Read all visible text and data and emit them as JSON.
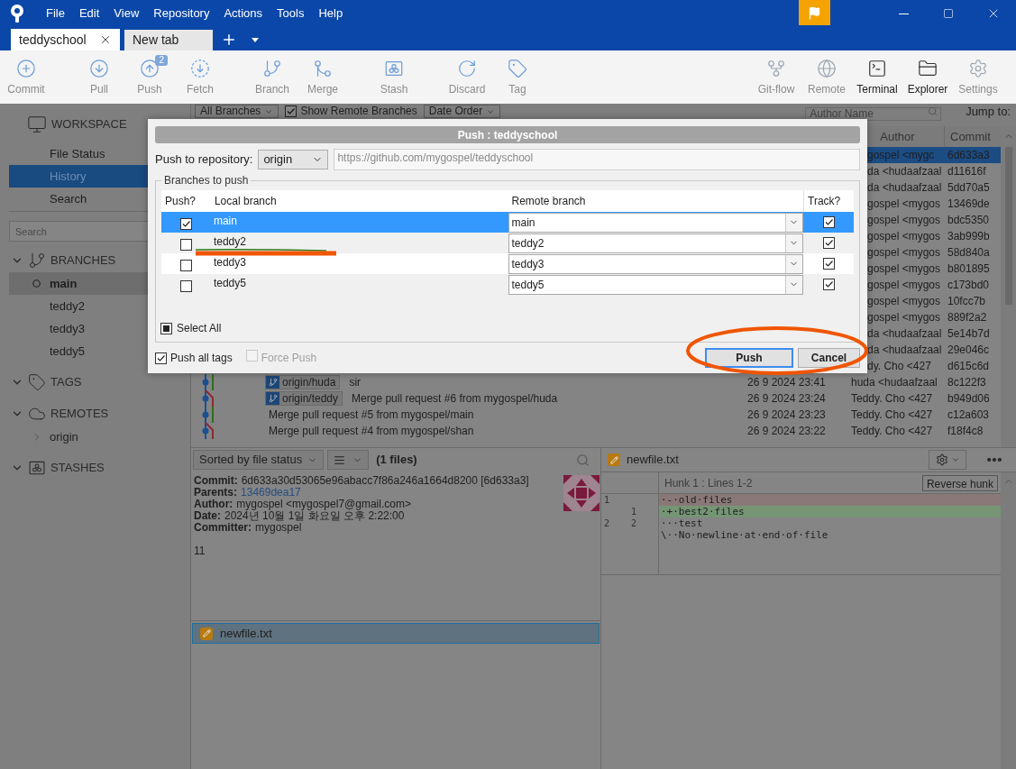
{
  "menu": [
    "File",
    "Edit",
    "View",
    "Repository",
    "Actions",
    "Tools",
    "Help"
  ],
  "tabs": [
    {
      "label": "teddyschool",
      "selected": true
    },
    {
      "label": "New tab",
      "selected": false
    }
  ],
  "toolbar": {
    "left": [
      {
        "kind": "commit",
        "label": "Commit",
        "highlighted": false
      },
      {
        "kind": "pull",
        "label": "Pull",
        "highlighted": false
      },
      {
        "kind": "push",
        "label": "Push",
        "badge": "2",
        "highlighted": false
      },
      {
        "kind": "fetch",
        "label": "Fetch",
        "highlighted": false
      },
      {
        "kind": "branch",
        "label": "Branch",
        "highlighted": false
      },
      {
        "kind": "merge",
        "label": "Merge",
        "highlighted": false
      },
      {
        "kind": "stash",
        "label": "Stash",
        "highlighted": false
      },
      {
        "kind": "discard",
        "label": "Discard",
        "highlighted": false
      },
      {
        "kind": "tag",
        "label": "Tag",
        "highlighted": false
      }
    ],
    "right": [
      {
        "kind": "gitflow",
        "label": "Git-flow",
        "highlighted": false
      },
      {
        "kind": "remote",
        "label": "Remote",
        "highlighted": false
      },
      {
        "kind": "terminal",
        "label": "Terminal",
        "highlighted": true
      },
      {
        "kind": "explorer",
        "label": "Explorer",
        "highlighted": true
      },
      {
        "kind": "settings",
        "label": "Settings",
        "highlighted": false
      }
    ]
  },
  "sidebar": {
    "workspace": {
      "label": "WORKSPACE",
      "items": [
        {
          "label": "File Status",
          "selected": false
        },
        {
          "label": "History",
          "selected": true
        },
        {
          "label": "Search",
          "selected": false
        }
      ]
    },
    "search": {
      "placeholder": "Search"
    },
    "sections": [
      {
        "kind": "branches",
        "label": "BRANCHES",
        "expanded": true,
        "items": [
          {
            "label": "main",
            "selected": true,
            "current": true
          },
          {
            "label": "teddy2",
            "selected": false,
            "current": false
          },
          {
            "label": "teddy3",
            "selected": false,
            "current": false
          },
          {
            "label": "teddy5",
            "selected": false,
            "current": false
          }
        ]
      },
      {
        "kind": "tags",
        "label": "TAGS",
        "expanded": true
      },
      {
        "kind": "remotes",
        "label": "REMOTES",
        "expanded": true,
        "items": [
          {
            "label": "origin",
            "expanded": false
          }
        ]
      },
      {
        "kind": "stashes",
        "label": "STASHES",
        "expanded": true
      }
    ]
  },
  "history": {
    "filters": {
      "branches": "All Branches",
      "show_remote": {
        "label": "Show Remote Branches",
        "checked": true
      },
      "order": "Date Order",
      "author_search": {
        "placeholder": "Author Name"
      },
      "jump_label": "Jump to:"
    },
    "columns": [
      "Author",
      "Commit"
    ],
    "rows": [
      {
        "author": "gospel <mygc",
        "commit": "6d633a3",
        "selected": true
      },
      {
        "author": "da <hudaafzaal",
        "commit": "d11616f",
        "selected": false
      },
      {
        "author": "da <hudaafzaal",
        "commit": "5dd70a5",
        "selected": false
      },
      {
        "author": "gospel <mygos",
        "commit": "13469de",
        "selected": false
      },
      {
        "author": "gospel <mygos",
        "commit": "bdc5350",
        "selected": false
      },
      {
        "author": "gospel <mygos",
        "commit": "3ab999b",
        "selected": false
      },
      {
        "author": "gospel <mygos",
        "commit": "58d840a",
        "selected": false
      },
      {
        "author": "gospel <mygos",
        "commit": "b801895",
        "selected": false
      },
      {
        "author": "gospel <mygos",
        "commit": "c173bd0",
        "selected": false
      },
      {
        "author": "gospel <mygos",
        "commit": "10fcc7b",
        "selected": false
      },
      {
        "author": "gospel <mygos",
        "commit": "889f2a2",
        "selected": false
      },
      {
        "author": "da <hudaafzaal",
        "commit": "5e14b7d",
        "selected": false
      },
      {
        "author": "da <hudaafzaal",
        "commit": "29e046c",
        "selected": false
      },
      {
        "author": "dy. Cho <427",
        "commit": "d615c6d",
        "selected": false
      },
      {
        "refs": [
          "origin/huda"
        ],
        "message": "sir",
        "date": "26 9 2024 23:41",
        "author": "huda <hudaafzaal",
        "commit": "8c122f3",
        "selected": false
      },
      {
        "refs": [
          "origin/teddy"
        ],
        "message": "Merge pull request #6 from mygospel/huda",
        "date": "26 9 2024 23:24",
        "author": "Teddy. Cho <427",
        "commit": "b949d06",
        "selected": false
      },
      {
        "message": "Merge pull request #5 from mygospel/main",
        "date": "26 9 2024 23:23",
        "author": "Teddy. Cho <427",
        "commit": "c12a603",
        "selected": false
      },
      {
        "message": "Merge pull request #4 from mygospel/shan",
        "date": "26 9 2024 23:22",
        "author": "Teddy. Cho <427",
        "commit": "f18f4c8",
        "selected": false
      }
    ]
  },
  "file_pane": {
    "sort": "Sorted by file status",
    "files_count": "(1 files)",
    "details": [
      {
        "kind": "text",
        "label": "Commit:",
        "value": "6d633a30d53065e96abacc7f86a246a1664d8200 [6d633a3]"
      },
      {
        "kind": "link",
        "label": "Parents:",
        "value": "13469dea17"
      },
      {
        "kind": "text",
        "label": "Author:",
        "value": "mygospel <mygospel7@gmail.com>"
      },
      {
        "kind": "text",
        "label": "Date:",
        "value": "2024년 10월 1일 화요일 오후 2:22:00"
      },
      {
        "kind": "text",
        "label": "Committer:",
        "value": "mygospel"
      }
    ],
    "message": "11",
    "files": [
      {
        "name": "newfile.txt",
        "selected": true
      }
    ]
  },
  "diff": {
    "file": "newfile.txt",
    "hunk_title": "Hunk 1 : Lines 1-2",
    "reverse_label": "Reverse hunk",
    "lines": [
      {
        "kind": "removed",
        "old": "1",
        "text": "·-·old·files"
      },
      {
        "kind": "added",
        "new": "1",
        "text": "·+·best2·files"
      },
      {
        "kind": "context",
        "old": "2",
        "new": "2",
        "text": "···test"
      },
      {
        "kind": "context",
        "text": "\\··No·newline·at·end·of·file"
      }
    ]
  },
  "push_dialog": {
    "title": "Push : teddyschool",
    "repository_label": "Push to repository:",
    "repository": "origin",
    "url": "https://github.com/mygospel/teddyschool",
    "group_label": "Branches to push",
    "columns": [
      "Push?",
      "Local branch",
      "Remote branch",
      "Track?"
    ],
    "branches": [
      {
        "local": "main",
        "push": true,
        "remote": "main",
        "track": true,
        "selected": true
      },
      {
        "local": "teddy2",
        "push": false,
        "remote": "teddy2",
        "track": true,
        "selected": false
      },
      {
        "local": "teddy3",
        "push": false,
        "remote": "teddy3",
        "track": true,
        "selected": false
      },
      {
        "local": "teddy5",
        "push": false,
        "remote": "teddy5",
        "track": true,
        "selected": false
      }
    ],
    "select_all": {
      "label": "Select All",
      "indeterminate": true
    },
    "push_all_tags": {
      "label": "Push all tags",
      "checked": true
    },
    "force_push": {
      "label": "Force Push",
      "checked": false,
      "disabled": true
    },
    "buttons": [
      {
        "label": "Push",
        "default": true
      },
      {
        "label": "Cancel",
        "default": false
      }
    ]
  }
}
